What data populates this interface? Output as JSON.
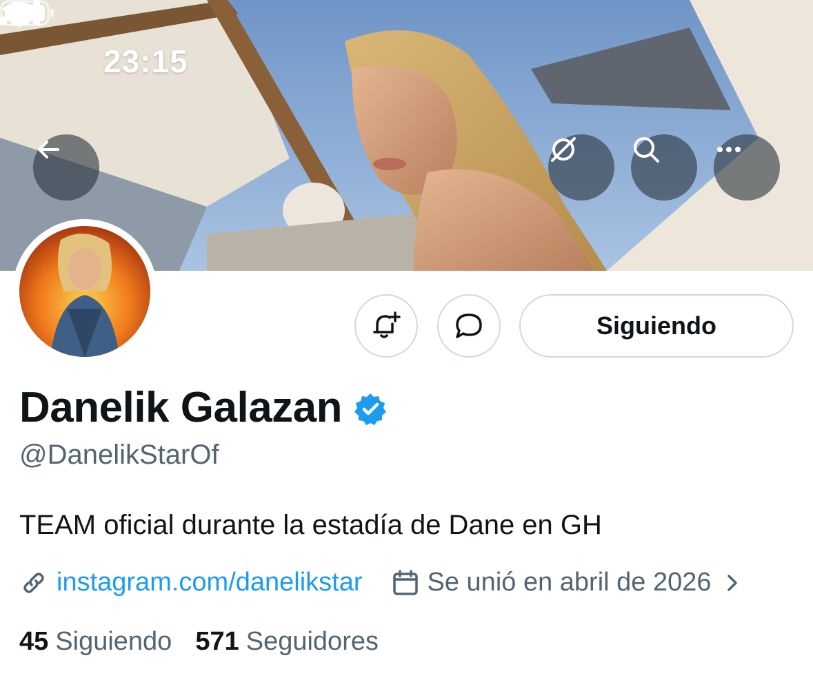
{
  "status_bar": {
    "time": "23:15"
  },
  "header": {
    "back_icon": "arrow-left-icon",
    "grok_icon": "grok-icon",
    "search_icon": "search-icon",
    "more_icon": "more-horizontal-icon"
  },
  "actions": {
    "notify_icon": "bell-plus-icon",
    "message_icon": "message-bubble-icon",
    "follow_label": "Siguiendo"
  },
  "profile": {
    "display_name": "Danelik Galazan",
    "handle": "@DanelikStarOf",
    "bio": "TEAM oficial durante la estadía de Dane en GH",
    "link": "instagram.com/danelikstar",
    "joined": "Se unió en abril de 2026"
  },
  "stats": {
    "following_count": "45",
    "following_label": "Siguiendo",
    "followers_count": "571",
    "followers_label": "Seguidores"
  },
  "colors": {
    "accent": "#1d9bf0",
    "verified": "#1d9bf0",
    "text_primary": "#0f1419",
    "text_secondary": "#536471",
    "border": "#cfd9de"
  }
}
